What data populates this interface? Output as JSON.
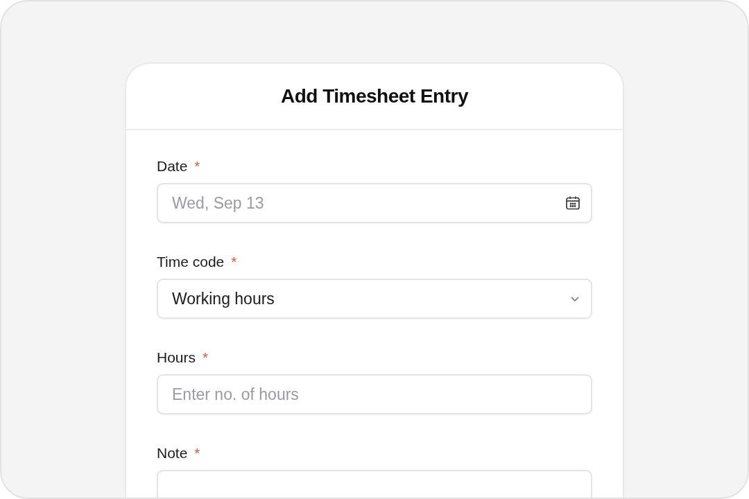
{
  "dialog": {
    "title": "Add Timesheet Entry"
  },
  "fields": [
    {
      "kind": "date",
      "label": "Date",
      "required_mark": "*",
      "placeholder": "Wed, Sep 13"
    },
    {
      "kind": "select",
      "label": "Time code",
      "required_mark": "*",
      "value": "Working hours"
    },
    {
      "kind": "text",
      "label": "Hours",
      "required_mark": "*",
      "placeholder": "Enter no. of hours"
    },
    {
      "kind": "text",
      "label": "Note",
      "required_mark": "*"
    }
  ]
}
